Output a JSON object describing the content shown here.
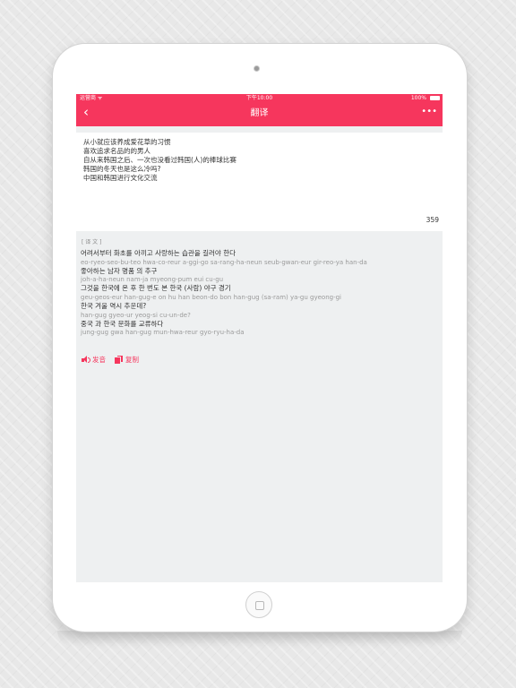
{
  "status_bar": {
    "carrier": "运营商 ᯤ",
    "time": "下午10:00",
    "battery": "100%"
  },
  "nav": {
    "back_icon": "chevron-left-icon",
    "title": "翻译",
    "more_icon": "more-dots-icon",
    "more_label": "•••"
  },
  "input": {
    "lines": [
      "从小就应该养成爱花草的习惯",
      "喜欢追求名品的的男人",
      "自从来韩国之后、一次也没看过韩国(人)的棒球比赛",
      "韩国的冬天也是这么冷吗?",
      "中国和韩国进行文化交流"
    ],
    "char_count": "359"
  },
  "result": {
    "label": "[ 译 文 ]",
    "items": [
      {
        "korean": "어려서부터 화초를 아끼고 사랑하는 습관을 길러야 한다",
        "romanization": "eo-ryeo-seo-bu-teo hwa-co-reur a-ggi-go sa-rang-ha-neun seub-gwan-eur gir-reo-ya han-da"
      },
      {
        "korean": "좋아하는 남자 명품 의 추구",
        "romanization": "joh-a-ha-neun nam-ja myeong-pum eui cu-gu"
      },
      {
        "korean": "그것을 한국에 온 후 한 번도 본 한국 (사람) 야구 경기",
        "romanization": "geu-geos-eur han-gug-e on hu han beon-do bon han-gug (sa-ram) ya-gu gyeong-gi"
      },
      {
        "korean": "한국 겨울 역시 추운데?",
        "romanization": "han-gug gyeo-ur yeog-si cu-un-de?"
      },
      {
        "korean": "중국 과 한국 문화를 교류하다",
        "romanization": "jung-gug gwa han-gug mun-hwa-reur gyo-ryu-ha-da"
      }
    ],
    "actions": {
      "speak_label": "发音",
      "speak_icon": "speaker-icon",
      "copy_label": "复制",
      "copy_icon": "copy-icon"
    }
  },
  "colors": {
    "accent": "#f6365d",
    "background": "#eef0f1"
  }
}
